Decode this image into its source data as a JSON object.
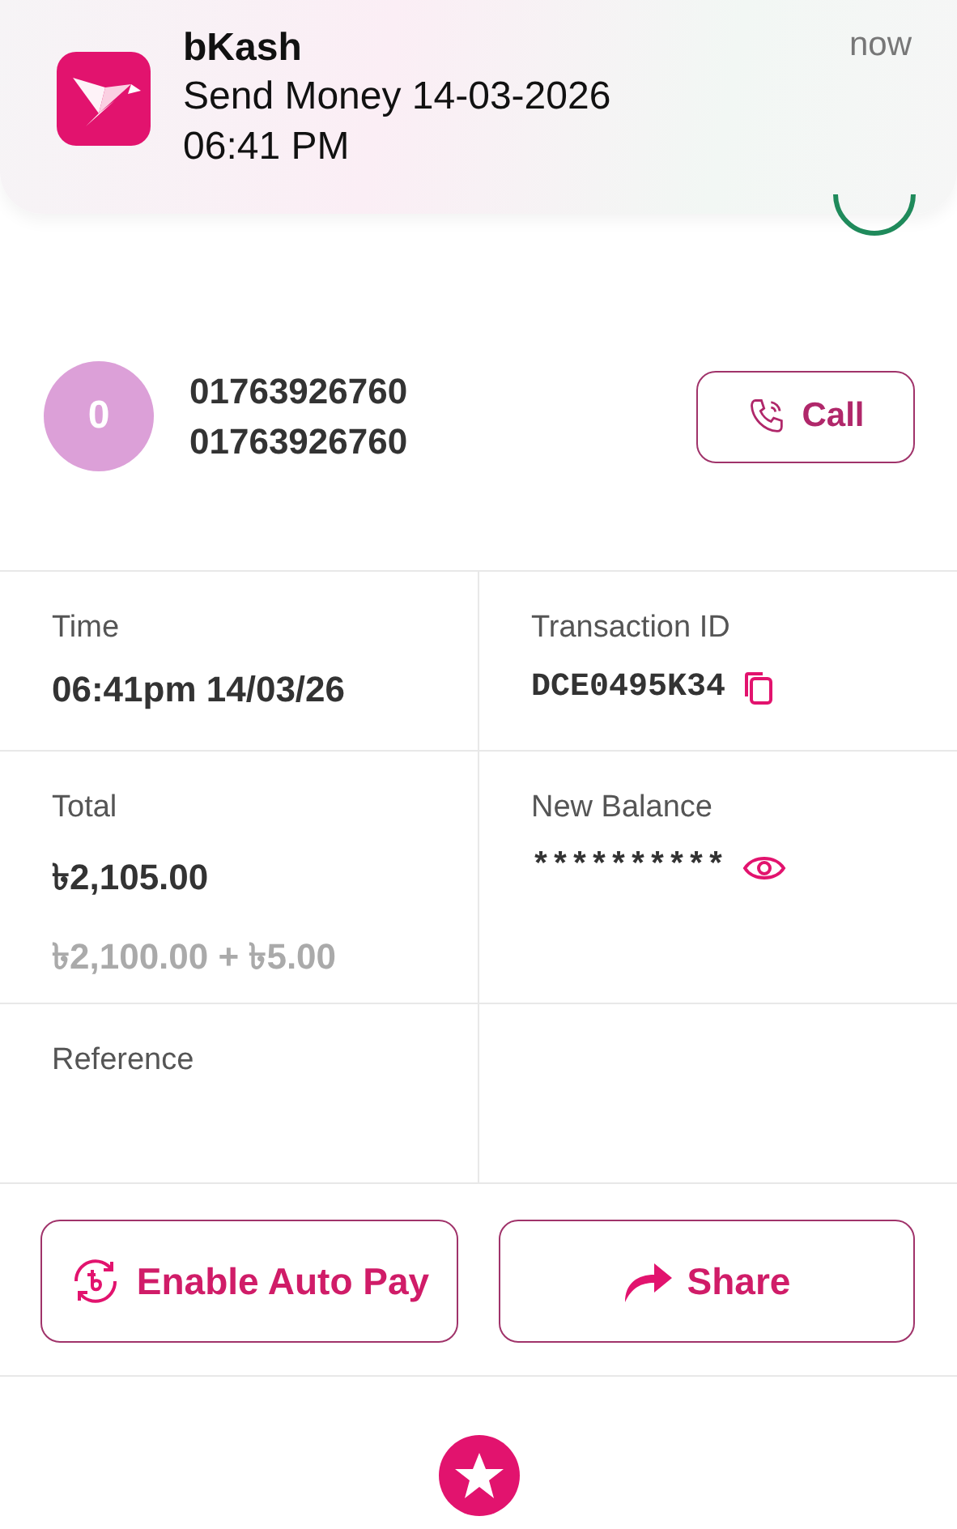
{
  "notification": {
    "app": "bKash",
    "message": "Send Money 14-03-2026 06:41 PM",
    "time": "now"
  },
  "contact": {
    "initial": "0",
    "name": "01763926760",
    "number": "01763926760",
    "call_label": "Call"
  },
  "details": [
    {
      "label": "Time",
      "value": "06:41pm 14/03/26",
      "kind": "plain"
    },
    {
      "label": "Transaction ID",
      "value": "DCE0495K34",
      "kind": "copy"
    },
    {
      "label": "Total",
      "value": "৳2,105.00",
      "note": "৳2,100.00 + ৳5.00",
      "kind": "plain"
    },
    {
      "label": "New Balance",
      "value": "**********",
      "kind": "hidden"
    },
    {
      "label": "Reference"
    }
  ],
  "actions": [
    {
      "label": "Enable Auto Pay",
      "kind": "autopay"
    },
    {
      "label": "Share",
      "kind": "share"
    }
  ]
}
